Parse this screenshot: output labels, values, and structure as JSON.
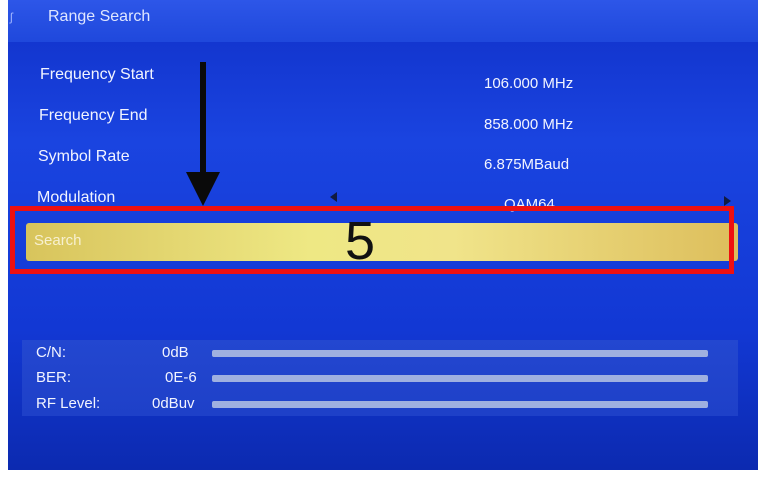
{
  "title": "Range Search",
  "fields": [
    {
      "label": "Frequency Start",
      "value": "106.000 MHz"
    },
    {
      "label": "Frequency End",
      "value": "858.000 MHz"
    },
    {
      "label": "Symbol Rate",
      "value": "6.875MBaud"
    },
    {
      "label": "Modulation",
      "value": "QAM64"
    }
  ],
  "search_label": "Search",
  "annotation_number": "5",
  "signal": [
    {
      "label": "C/N:",
      "value": "0dB",
      "level": 0
    },
    {
      "label": "BER:",
      "value": "0E-6",
      "level": 0
    },
    {
      "label": "RF Level:",
      "value": "0dBuv",
      "level": 0
    }
  ],
  "colors": {
    "background": "#1238d4",
    "selected_row": "#eee884",
    "highlight_box": "#ee1010"
  }
}
